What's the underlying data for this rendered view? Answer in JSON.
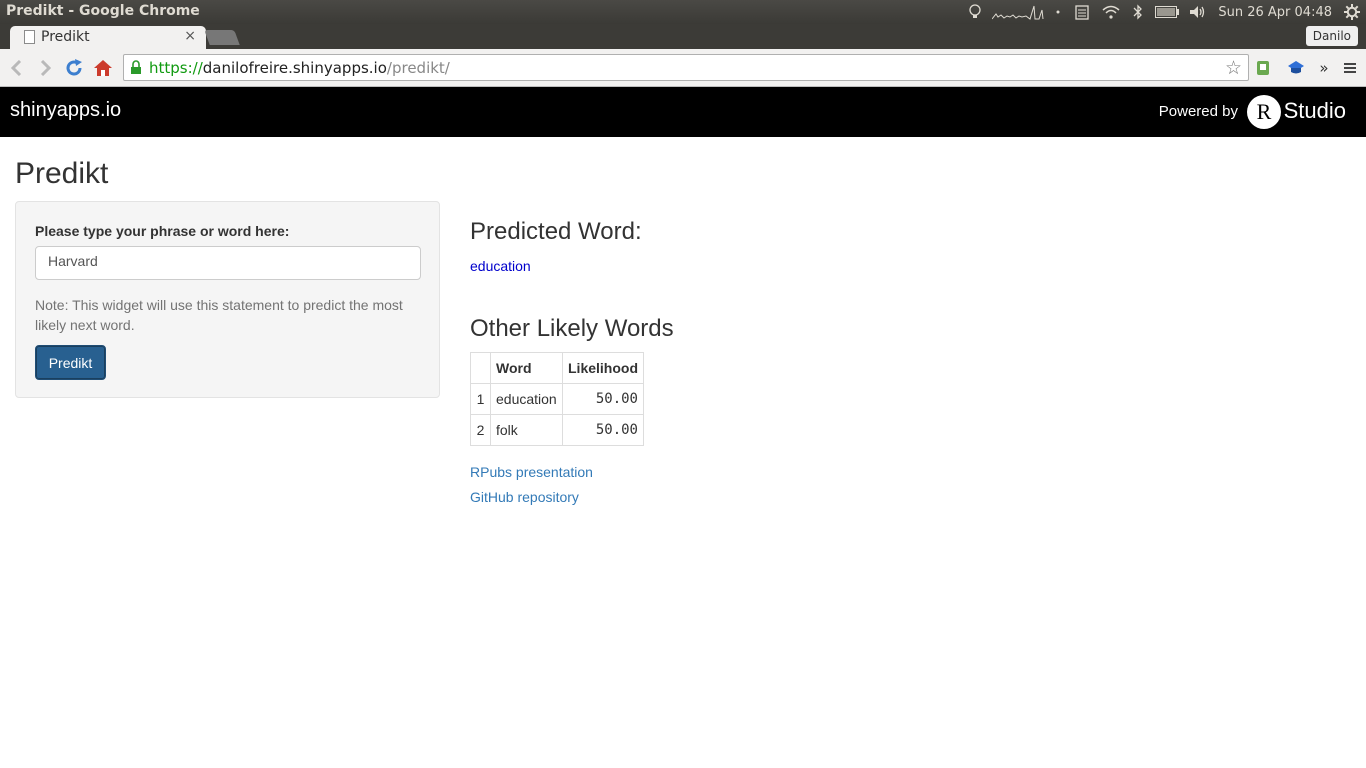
{
  "window": {
    "title": "Predikt - Google Chrome"
  },
  "system_tray": {
    "icons": [
      "lightbulb-icon",
      "system-load-graph-icon",
      "clipboard-icon",
      "wifi-icon",
      "bluetooth-icon",
      "battery-icon",
      "volume-icon",
      "settings-gear-icon"
    ],
    "clock": "Sun 26 Apr 04:48"
  },
  "browser": {
    "tab": {
      "label": "Predikt",
      "close": "×"
    },
    "profile_name": "Danilo",
    "url": {
      "scheme": "https://",
      "host": "danilofreire.shinyapps.io",
      "path": "/predikt/"
    },
    "overflow": "»"
  },
  "shinyapps_header": {
    "brand": "shinyapps.io",
    "powered_by": "Powered by",
    "logo_letter": "R",
    "logo_word": "Studio"
  },
  "app": {
    "title": "Predikt",
    "sidebar": {
      "input_label": "Please type your phrase or word here:",
      "input_value": "Harvard",
      "note": "Note: This widget will use this statement to predict the most likely next word.",
      "button_label": "Predikt"
    },
    "main": {
      "predicted_heading": "Predicted Word:",
      "predicted_word": "education",
      "others_heading": "Other Likely Words",
      "table": {
        "headers": [
          "",
          "Word",
          "Likelihood"
        ],
        "rows": [
          {
            "index": "1",
            "word": "education",
            "likelihood": "50.00"
          },
          {
            "index": "2",
            "word": "folk",
            "likelihood": "50.00"
          }
        ]
      },
      "links": [
        "RPubs presentation",
        "GitHub repository"
      ]
    }
  },
  "colors": {
    "button": "#286090",
    "link": "#337ab7",
    "prediction": "#0000cc",
    "header_bg": "#000000",
    "secure_url": "#109a10"
  }
}
